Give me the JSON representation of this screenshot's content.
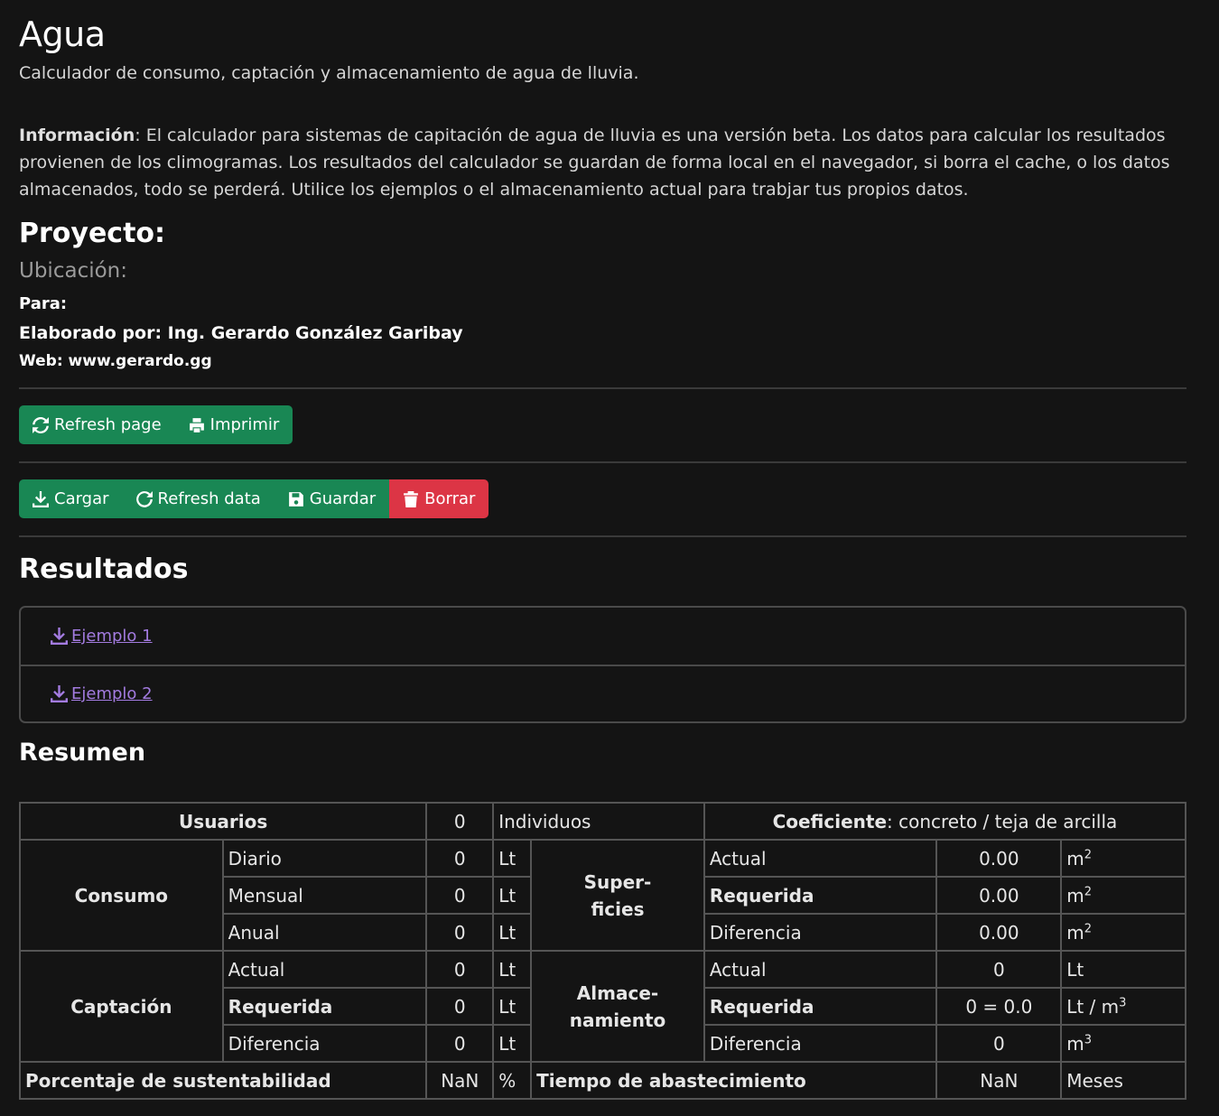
{
  "header": {
    "title": "Agua",
    "subtitle": "Calculador de consumo, captación y almacenamiento de agua de lluvia.",
    "info_label": "Información",
    "info_text": ": El calculador para sistemas de capitación de agua de lluvia es una versión beta. Los datos para calcular los resultados provienen de los climogramas. Los resultados del calculador se guardan de forma local en el navegador, si borra el cache, o los datos almacenados, todo se perderá. Utilice los ejemplos o el almacenamiento actual para trabjar tus propios datos."
  },
  "project": {
    "title": "Proyecto:",
    "location": "Ubicación:",
    "for": "Para:",
    "author": "Elaborado por: Ing. Gerardo González Garibay",
    "web": "Web: www.gerardo.gg"
  },
  "toolbar1": {
    "refresh_page": "Refresh page",
    "print": "Imprimir"
  },
  "toolbar2": {
    "load": "Cargar",
    "refresh_data": "Refresh data",
    "save": "Guardar",
    "delete": "Borrar"
  },
  "results": {
    "title": "Resultados",
    "examples": [
      "Ejemplo 1",
      "Ejemplo 2"
    ]
  },
  "summary": {
    "title": "Resumen",
    "users_label": "Usuarios",
    "users_value": "0",
    "users_unit": "Individuos",
    "coef_label": "Coeficiente",
    "coef_value": ": concreto / teja de arcilla",
    "consumo_label": "Consumo",
    "consumo_rows": [
      {
        "label": "Diario",
        "value": "0",
        "unit": "Lt"
      },
      {
        "label": "Mensual",
        "value": "0",
        "unit": "Lt"
      },
      {
        "label": "Anual",
        "value": "0",
        "unit": "Lt"
      }
    ],
    "captacion_label": "Captación",
    "captacion_rows": [
      {
        "label": "Actual",
        "value": "0",
        "unit": "Lt"
      },
      {
        "label": "Requerida",
        "value": "0",
        "unit": "Lt"
      },
      {
        "label": "Diferencia",
        "value": "0",
        "unit": "Lt"
      }
    ],
    "superficies_label_1": "Super-",
    "superficies_label_2": "ficies",
    "superficies_rows": [
      {
        "label": "Actual",
        "value": "0.00",
        "unit": "m",
        "sup": "2"
      },
      {
        "label": "Requerida",
        "value": "0.00",
        "unit": "m",
        "sup": "2"
      },
      {
        "label": "Diferencia",
        "value": "0.00",
        "unit": "m",
        "sup": "2"
      }
    ],
    "almacenamiento_label_1": "Almace-",
    "almacenamiento_label_2": "namiento",
    "almacenamiento_rows": [
      {
        "label": "Actual",
        "value": "0",
        "unit": "Lt",
        "sup": ""
      },
      {
        "label": "Requerida",
        "value": "0 = 0.0",
        "unit": "Lt / m",
        "sup": "3"
      },
      {
        "label": "Diferencia",
        "value": "0",
        "unit": "m",
        "sup": "3"
      }
    ],
    "sust_label": "Porcentaje de sustentabilidad",
    "sust_value": "NaN",
    "sust_unit": "%",
    "tiempo_label": "Tiempo de abastecimiento",
    "tiempo_value": "NaN",
    "tiempo_unit": "Meses"
  }
}
